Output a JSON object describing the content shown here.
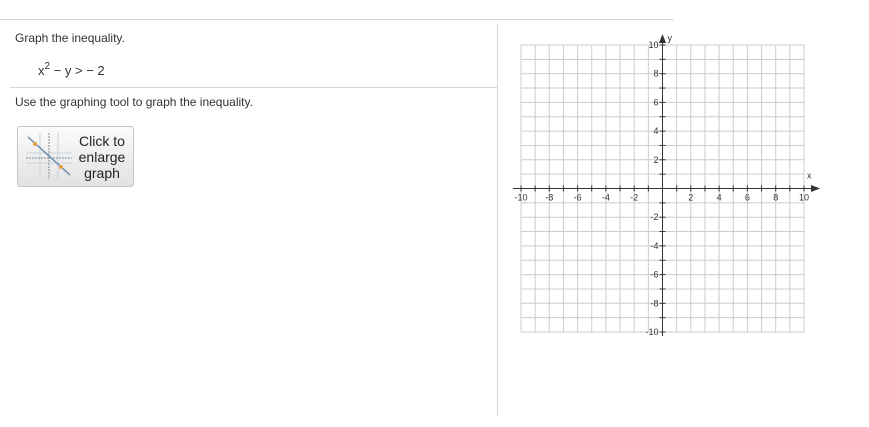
{
  "question": {
    "prompt": "Graph the inequality.",
    "expression_base": "x",
    "expression_exp": "2",
    "expression_rest": " − y >  − 2",
    "instruction": "Use the graphing tool to graph the inequality."
  },
  "enlarge_button": {
    "line1": "Click to",
    "line2": "enlarge",
    "line3": "graph",
    "icon": "graph-thumbnail-icon"
  },
  "graph": {
    "x_label": "x",
    "y_label": "y",
    "x_min": -10,
    "x_max": 10,
    "y_min": -10,
    "y_max": 10,
    "grid": true,
    "grid_step": 1,
    "x_tick_labels": [
      "-10",
      "-8",
      "-6",
      "-4",
      "-2",
      "2",
      "4",
      "6",
      "8",
      "10"
    ],
    "y_tick_labels": [
      "10",
      "8",
      "6",
      "4",
      "2",
      "-2",
      "-4",
      "-6",
      "-8",
      "-10"
    ]
  },
  "colors": {
    "grid": "#cccccc",
    "axis": "#333333",
    "thumb_points": "#e8a040"
  }
}
